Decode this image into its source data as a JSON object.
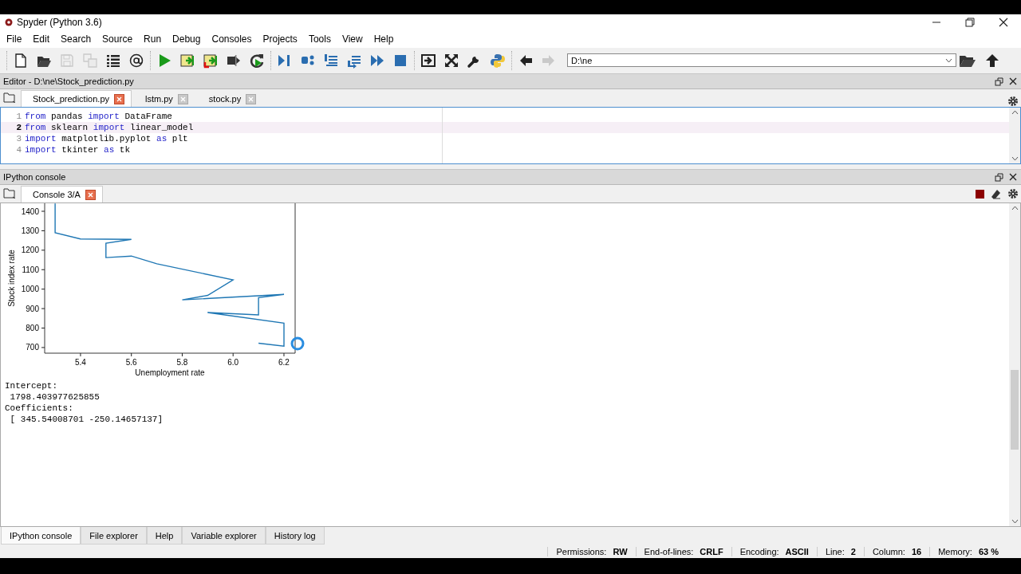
{
  "window": {
    "title": "Spyder (Python 3.6)"
  },
  "menu": [
    "File",
    "Edit",
    "Search",
    "Source",
    "Run",
    "Debug",
    "Consoles",
    "Projects",
    "Tools",
    "View",
    "Help"
  ],
  "toolbar": {
    "groups": [
      [
        {
          "kind": "new",
          "disabled": false
        },
        {
          "kind": "open",
          "disabled": false
        },
        {
          "kind": "save",
          "disabled": true
        },
        {
          "kind": "save_all",
          "disabled": true
        },
        {
          "kind": "outline",
          "disabled": false
        },
        {
          "kind": "at",
          "disabled": false
        }
      ],
      [
        {
          "kind": "run",
          "disabled": false
        },
        {
          "kind": "run_cell",
          "disabled": false
        },
        {
          "kind": "run_cell_advance",
          "disabled": false
        },
        {
          "kind": "run_selection",
          "disabled": false
        },
        {
          "kind": "rerun",
          "disabled": false
        }
      ],
      [
        {
          "kind": "debug",
          "disabled": false
        },
        {
          "kind": "step",
          "disabled": false
        },
        {
          "kind": "step_into",
          "disabled": false
        },
        {
          "kind": "step_return",
          "disabled": false
        },
        {
          "kind": "continue",
          "disabled": false
        },
        {
          "kind": "stop",
          "disabled": false
        }
      ],
      [
        {
          "kind": "maximize",
          "disabled": false
        },
        {
          "kind": "fullscreen",
          "disabled": false
        },
        {
          "kind": "preferences",
          "disabled": false
        },
        {
          "kind": "python",
          "disabled": false
        }
      ],
      [
        {
          "kind": "back",
          "disabled": false
        },
        {
          "kind": "forward",
          "disabled": true
        }
      ]
    ],
    "working_directory": {
      "value": "D:\\ne"
    }
  },
  "editor": {
    "title": "Editor - D:\\ne\\Stock_prediction.py",
    "tabs": [
      {
        "label": "Stock_prediction.py",
        "selected": true
      },
      {
        "label": "lstm.py",
        "selected": false
      },
      {
        "label": "stock.py",
        "selected": false
      }
    ],
    "lines": [
      {
        "number": "1",
        "current": false,
        "tokens": [
          {
            "text": "from",
            "kind": "keyword"
          },
          {
            "text": " pandas ",
            "kind": "plain"
          },
          {
            "text": "import",
            "kind": "keyword"
          },
          {
            "text": " DataFrame",
            "kind": "plain"
          }
        ]
      },
      {
        "number": "2",
        "current": true,
        "tokens": [
          {
            "text": "from",
            "kind": "keyword"
          },
          {
            "text": " sklearn ",
            "kind": "plain"
          },
          {
            "text": "import",
            "kind": "keyword"
          },
          {
            "text": " linear_model",
            "kind": "plain"
          }
        ]
      },
      {
        "number": "3",
        "current": false,
        "tokens": [
          {
            "text": "import",
            "kind": "keyword"
          },
          {
            "text": " matplotlib.pyplot ",
            "kind": "plain"
          },
          {
            "text": "as",
            "kind": "keyword"
          },
          {
            "text": " plt",
            "kind": "plain"
          }
        ]
      },
      {
        "number": "4",
        "current": false,
        "tokens": [
          {
            "text": "import",
            "kind": "keyword"
          },
          {
            "text": " tkinter ",
            "kind": "plain"
          },
          {
            "text": "as",
            "kind": "keyword"
          },
          {
            "text": " tk",
            "kind": "plain"
          }
        ]
      }
    ]
  },
  "console": {
    "title": "IPython console",
    "tabs": [
      {
        "label": "Console 3/A",
        "selected": true
      }
    ],
    "chart_data": {
      "type": "line",
      "xlabel": "Unemployment rate",
      "ylabel": "Stock index rate",
      "x": [
        5.3,
        5.3,
        5.4,
        5.6,
        5.5,
        5.5,
        5.6,
        5.7,
        6.0,
        5.9,
        5.8,
        6.2,
        6.1,
        6.1,
        5.9,
        6.2,
        6.2,
        6.1
      ],
      "series": [
        {
          "color": "#1f77b4",
          "values": [
            1440,
            1290,
            1258,
            1256,
            1236,
            1162,
            1170,
            1130,
            1048,
            968,
            945,
            973,
            956,
            868,
            880,
            825,
            707,
            722
          ]
        }
      ],
      "xlim": [
        5.259,
        6.244
      ],
      "ylim": [
        671,
        1441
      ],
      "xticks": [
        {
          "value": 5.4,
          "label": "5.4"
        },
        {
          "value": 5.6,
          "label": "5.6"
        },
        {
          "value": 5.8,
          "label": "5.8"
        },
        {
          "value": 6.0,
          "label": "6.0"
        },
        {
          "value": 6.2,
          "label": "6.2"
        }
      ],
      "yticks": [
        700,
        800,
        900,
        1000,
        1100,
        1200,
        1300,
        1400
      ]
    },
    "output": [
      "Intercept:",
      " 1798.403977625855",
      "Coefficients:",
      " [ 345.54008701 -250.14657137]"
    ]
  },
  "bottom_tabs": [
    {
      "label": "IPython console",
      "selected": true
    },
    {
      "label": "File explorer",
      "selected": false
    },
    {
      "label": "Help",
      "selected": false
    },
    {
      "label": "Variable explorer",
      "selected": false
    },
    {
      "label": "History log",
      "selected": false
    }
  ],
  "status_bar": [
    {
      "label": "Permissions:",
      "value": "RW"
    },
    {
      "label": "End-of-lines:",
      "value": "CRLF"
    },
    {
      "label": "Encoding:",
      "value": "ASCII"
    },
    {
      "label": "Line:",
      "value": "2"
    },
    {
      "label": "Column:",
      "value": "16"
    },
    {
      "label": "Memory:",
      "value": "63 %"
    }
  ]
}
